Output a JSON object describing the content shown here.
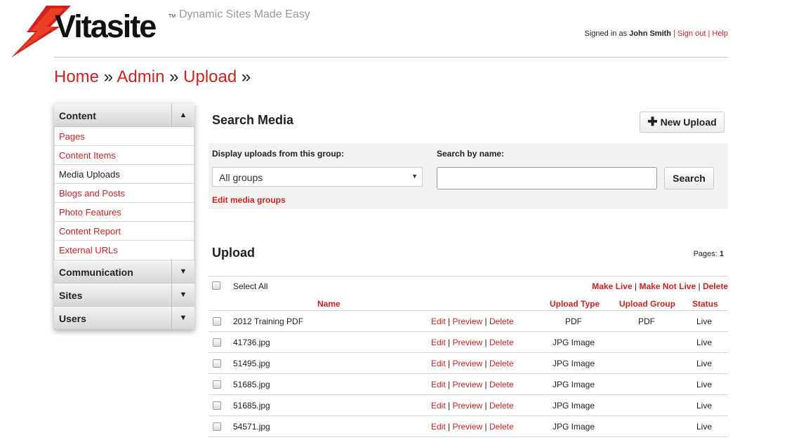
{
  "colors": {
    "accent": "#d42020",
    "panel": "#f2f2f2"
  },
  "header": {
    "logo_text": "Vitasite",
    "logo_tm": "TM",
    "tagline": "Dynamic Sites Made Easy",
    "signed_in_prefix": "Signed in as",
    "user_name": "John Smith",
    "sign_out": "Sign out",
    "help": "Help",
    "separator": "|"
  },
  "breadcrumb": {
    "items": [
      "Home",
      "Admin",
      "Upload"
    ],
    "separator": "»"
  },
  "sidebar": {
    "content": {
      "label": "Content",
      "toggle_icon": "▲",
      "items": [
        {
          "label": "Pages"
        },
        {
          "label": "Content Items"
        },
        {
          "label": "Media Uploads"
        },
        {
          "label": "Blogs and Posts"
        },
        {
          "label": "Photo Features"
        },
        {
          "label": "Content Report"
        },
        {
          "label": "External URLs"
        }
      ]
    },
    "sections": [
      {
        "label": "Communication",
        "toggle_icon": "▼"
      },
      {
        "label": "Sites",
        "toggle_icon": "▼"
      },
      {
        "label": "Users",
        "toggle_icon": "▼"
      }
    ]
  },
  "search_media": {
    "title": "Search Media",
    "new_upload_label": "New Upload",
    "group_label": "Display uploads from this group:",
    "group_selected": "All groups",
    "name_label": "Search by name:",
    "name_value": "",
    "search_button": "Search",
    "edit_groups": "Edit media groups"
  },
  "upload": {
    "title": "Upload",
    "pages_label": "Pages:",
    "pages_value": "1",
    "select_all": "Select All",
    "bulk_actions": [
      "Make Live",
      "Make Not Live",
      "Delete"
    ],
    "columns": {
      "name": "Name",
      "type": "Upload Type",
      "group": "Upload Group",
      "status": "Status"
    },
    "action_labels": {
      "edit": "Edit",
      "preview": "Preview",
      "delete": "Delete",
      "separator": "|"
    },
    "rows": [
      {
        "name": "2012 Training PDF",
        "type": "PDF",
        "group": "PDF",
        "status": "Live"
      },
      {
        "name": "41736.jpg",
        "type": "JPG Image",
        "group": "",
        "status": "Live"
      },
      {
        "name": "51495.jpg",
        "type": "JPG Image",
        "group": "",
        "status": "Live"
      },
      {
        "name": "51685.jpg",
        "type": "JPG Image",
        "group": "",
        "status": "Live"
      },
      {
        "name": "51685.jpg",
        "type": "JPG Image",
        "group": "",
        "status": "Live"
      },
      {
        "name": "54571.jpg",
        "type": "JPG Image",
        "group": "",
        "status": "Live"
      }
    ]
  }
}
